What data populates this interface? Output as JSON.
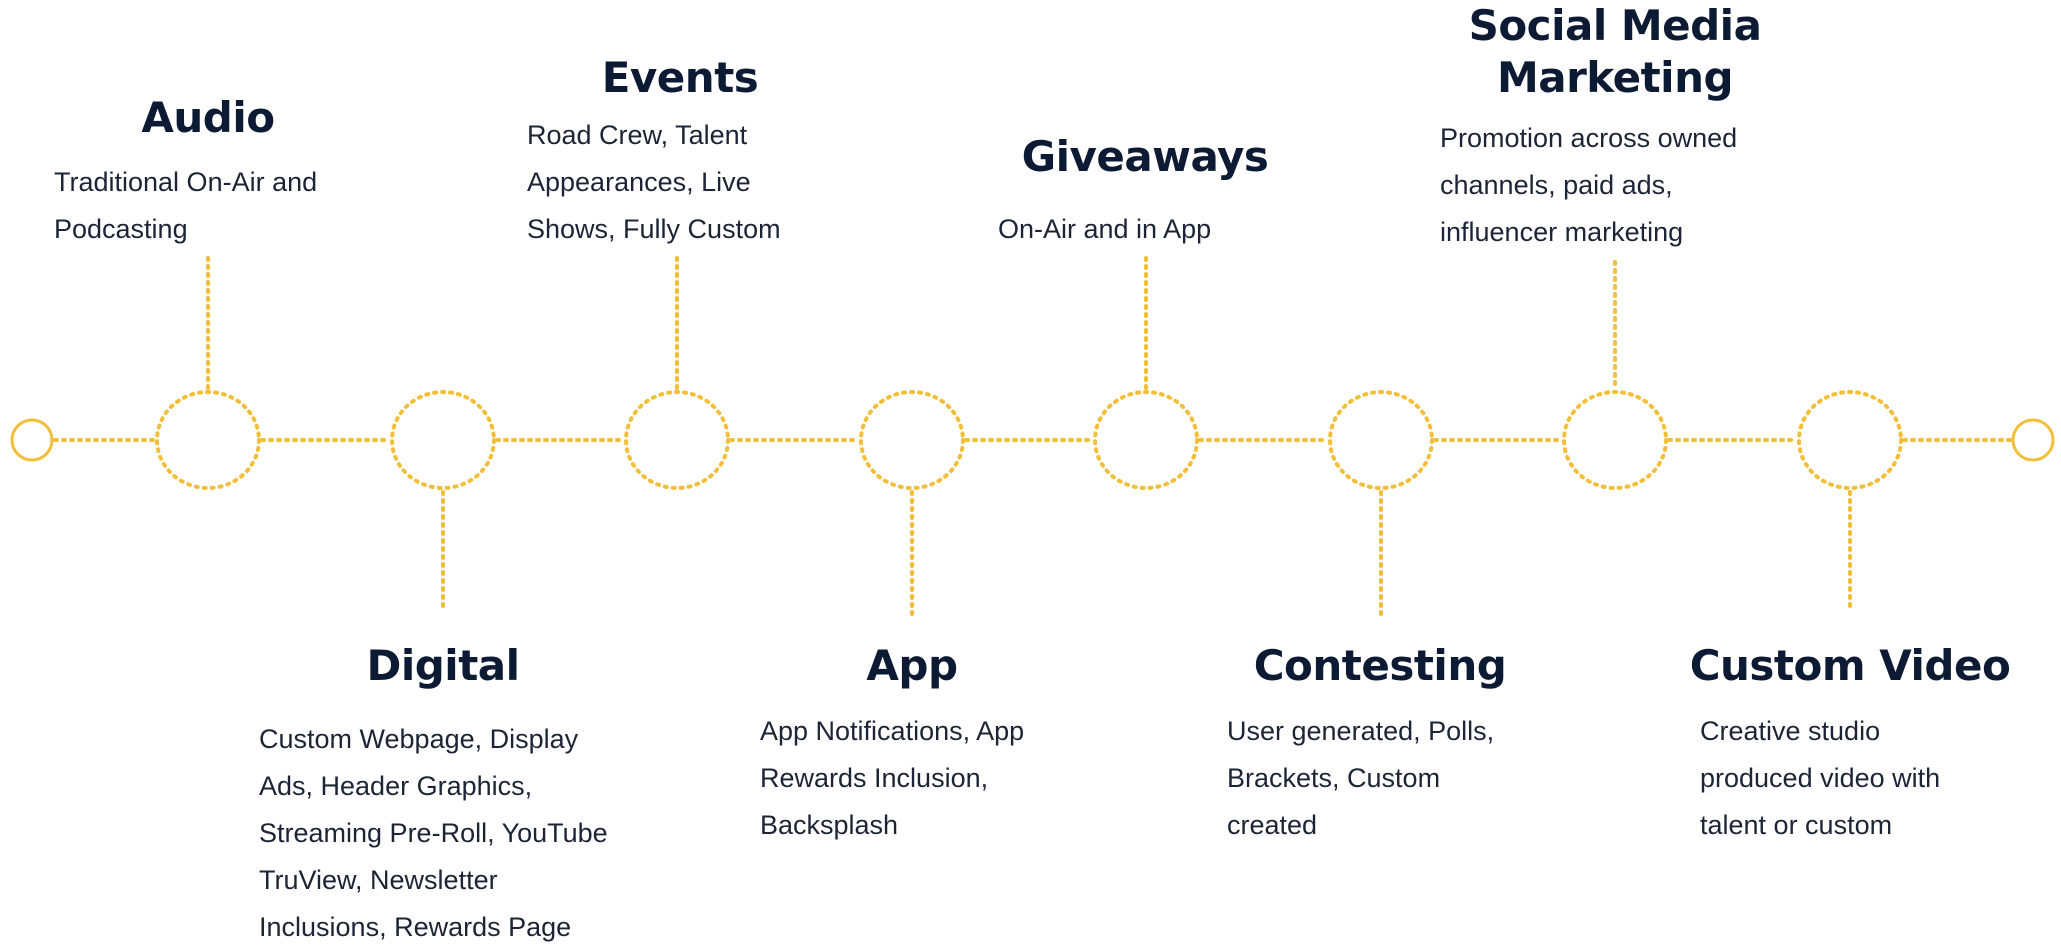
{
  "colors": {
    "accent": "#f2bf3a",
    "title": "#0c1a33",
    "text": "#1c2436"
  },
  "stages": [
    {
      "title": [
        "Audio"
      ],
      "lines": [
        "Traditional On-Air and",
        "Podcasting"
      ]
    },
    {
      "title": [
        "Digital"
      ],
      "lines": [
        "Custom Webpage, Display",
        "Ads, Header Graphics,",
        "Streaming Pre-Roll, YouTube",
        "TruView, Newsletter",
        "Inclusions, Rewards Page"
      ]
    },
    {
      "title": [
        "Events"
      ],
      "lines": [
        "Road Crew, Talent",
        "Appearances, Live",
        "Shows, Fully Custom"
      ]
    },
    {
      "title": [
        "App"
      ],
      "lines": [
        "App Notifications, App",
        "Rewards Inclusion,",
        "Backsplash"
      ]
    },
    {
      "title": [
        "Giveaways"
      ],
      "lines": [
        "On-Air and in App"
      ]
    },
    {
      "title": [
        "Contesting"
      ],
      "lines": [
        "User generated, Polls,",
        "Brackets, Custom",
        "created"
      ]
    },
    {
      "title": [
        "Social Media",
        "Marketing"
      ],
      "lines": [
        "Promotion across owned",
        "channels, paid ads,",
        "influencer marketing"
      ]
    },
    {
      "title": [
        "Custom Video"
      ],
      "lines": [
        "Creative studio",
        "produced video with",
        "talent or custom"
      ]
    }
  ]
}
